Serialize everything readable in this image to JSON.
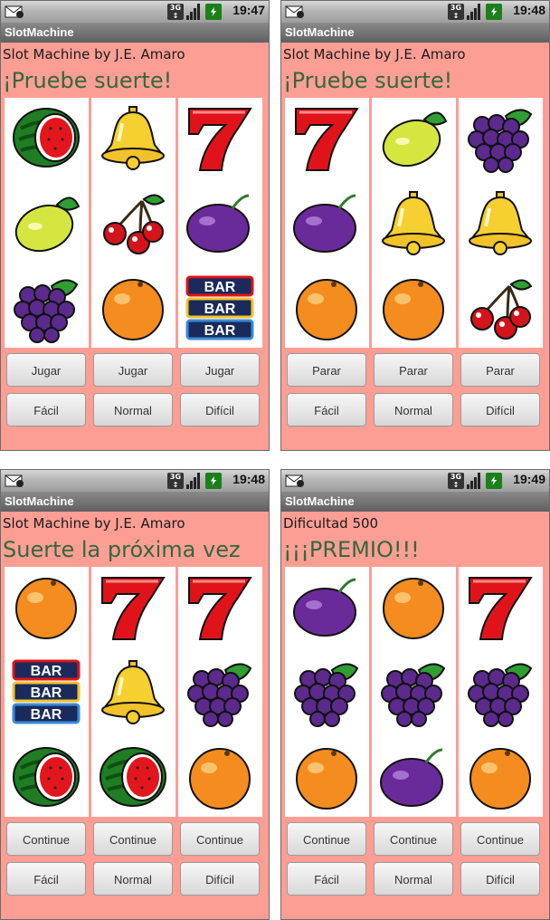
{
  "screens": [
    {
      "time": "19:47",
      "app_title": "SlotMachine",
      "subtitle": "Slot Machine by J.E. Amaro",
      "message": "¡Pruebe suerte!",
      "reels": [
        [
          "watermelon",
          "lemon",
          "grapes"
        ],
        [
          "bell",
          "cherry",
          "orange"
        ],
        [
          "seven",
          "plum",
          "bar"
        ]
      ],
      "action_buttons": [
        "Jugar",
        "Jugar",
        "Jugar"
      ],
      "difficulty_buttons": [
        "Fácil",
        "Normal",
        "Difícil"
      ]
    },
    {
      "time": "19:48",
      "app_title": "SlotMachine",
      "subtitle": "Slot Machine by J.E. Amaro",
      "message": "¡Pruebe suerte!",
      "reels": [
        [
          "seven",
          "plum",
          "orange"
        ],
        [
          "lemon",
          "bell",
          "orange"
        ],
        [
          "grapes",
          "bell",
          "cherry"
        ]
      ],
      "action_buttons": [
        "Parar",
        "Parar",
        "Parar"
      ],
      "difficulty_buttons": [
        "Fácil",
        "Normal",
        "Difícil"
      ]
    },
    {
      "time": "19:48",
      "app_title": "SlotMachine",
      "subtitle": "Slot Machine by J.E. Amaro",
      "message": "Suerte la próxima vez",
      "reels": [
        [
          "orange",
          "bar",
          "watermelon"
        ],
        [
          "seven",
          "bell",
          "watermelon"
        ],
        [
          "seven",
          "grapes",
          "orange"
        ]
      ],
      "action_buttons": [
        "Continue",
        "Continue",
        "Continue"
      ],
      "difficulty_buttons": [
        "Fácil",
        "Normal",
        "Difícil"
      ]
    },
    {
      "time": "19:49",
      "app_title": "SlotMachine",
      "subtitle": "Dificultad 500",
      "message": "¡¡¡PREMIO!!!",
      "reels": [
        [
          "plum",
          "grapes",
          "orange"
        ],
        [
          "orange",
          "grapes",
          "plum"
        ],
        [
          "seven",
          "grapes",
          "orange"
        ]
      ],
      "action_buttons": [
        "Continue",
        "Continue",
        "Continue"
      ],
      "difficulty_buttons": [
        "Fácil",
        "Normal",
        "Difícil"
      ]
    }
  ],
  "colors": {
    "background": "#fd9e95",
    "message_text": "#35683c",
    "seven_red": "#e0131b",
    "bar_text": "#ffffff"
  },
  "symbols": {
    "bar_label": "BAR"
  }
}
